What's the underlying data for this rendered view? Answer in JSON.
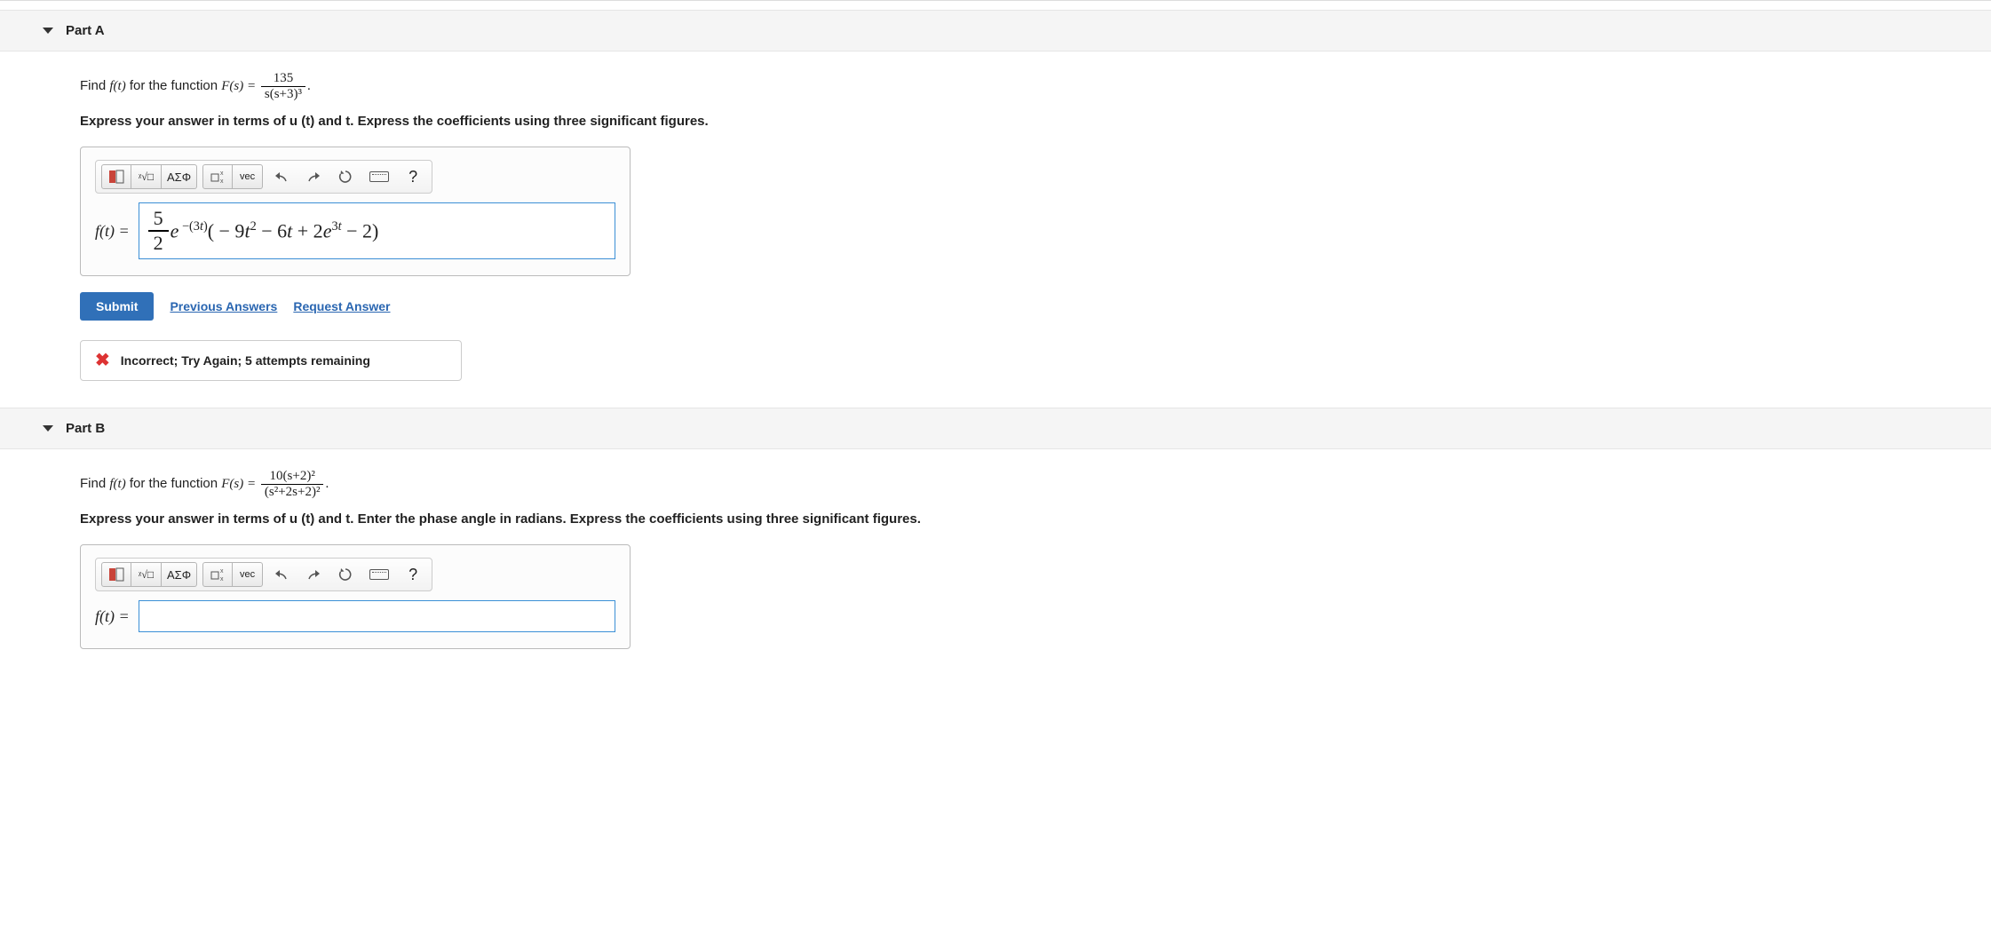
{
  "parts": {
    "a": {
      "title": "Part A",
      "prompt_prefix": "Find ",
      "prompt_func": "f(t)",
      "prompt_mid": " for the function ",
      "prompt_Fs": "F(s) = ",
      "frac_num": "135",
      "frac_den": "s(s+3)³",
      "period": ".",
      "instruction": "Express your answer in terms of u (t) and t. Express the coefficients using three significant figures.",
      "lhs": "f(t) =",
      "answer_frac_num": "5",
      "answer_frac_den": "2",
      "answer_rest": "e⁻⁽³ᵗ⁾( − 9t² − 6t + 2e³ᵗ − 2)",
      "submit": "Submit",
      "prev": "Previous Answers",
      "request": "Request Answer",
      "feedback": "Incorrect; Try Again; 5 attempts remaining"
    },
    "b": {
      "title": "Part B",
      "prompt_prefix": "Find ",
      "prompt_func": "f(t)",
      "prompt_mid": " for the function ",
      "prompt_Fs": "F(s) = ",
      "frac_num": "10(s+2)²",
      "frac_den": "(s²+2s+2)²",
      "period": ".",
      "instruction": "Express your answer in terms of u (t) and t. Enter the phase angle in radians. Express the coefficients using three significant figures.",
      "lhs": "f(t) ="
    }
  },
  "toolbar": {
    "templates": "□",
    "math": "ᵡ√□",
    "greek": "ΑΣΦ",
    "subscript": "↓↑",
    "vec": "vec",
    "undo": "↶",
    "redo": "↷",
    "reset": "↻",
    "keyboard": "⌨",
    "help": "?"
  }
}
